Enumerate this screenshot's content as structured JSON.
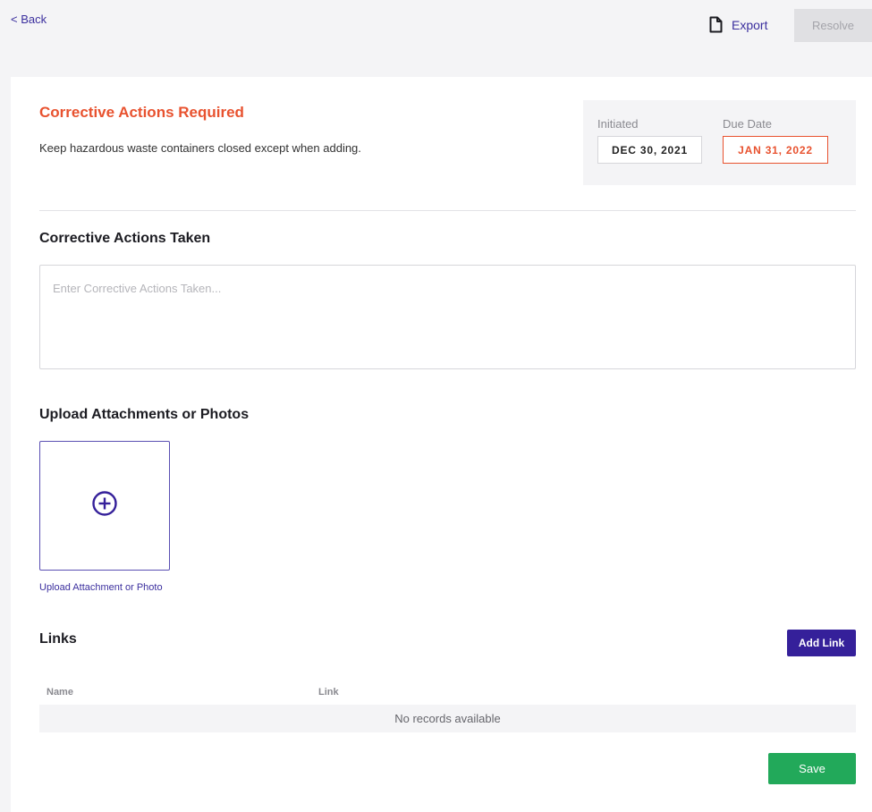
{
  "header": {
    "back_label": "< Back",
    "export_label": "Export",
    "export_icon": "document-icon",
    "resolve_label": "Resolve"
  },
  "required": {
    "title": "Corrective Actions Required",
    "description": "Keep hazardous waste containers closed except when adding."
  },
  "dates": {
    "initiated_label": "Initiated",
    "initiated_value": "DEC 30, 2021",
    "due_label": "Due Date",
    "due_value": "JAN 31, 2022"
  },
  "taken": {
    "title": "Corrective Actions Taken",
    "placeholder": "Enter Corrective Actions Taken...",
    "value": ""
  },
  "upload": {
    "title": "Upload Attachments or Photos",
    "caption": "Upload Attachment or Photo",
    "icon": "plus-circle-icon"
  },
  "links": {
    "title": "Links",
    "add_label": "Add Link",
    "columns": [
      "Name",
      "Link"
    ],
    "empty_message": "No records available"
  },
  "save_label": "Save",
  "colors": {
    "accent": "#35209a",
    "alert": "#e8522f",
    "success": "#22a95a"
  }
}
